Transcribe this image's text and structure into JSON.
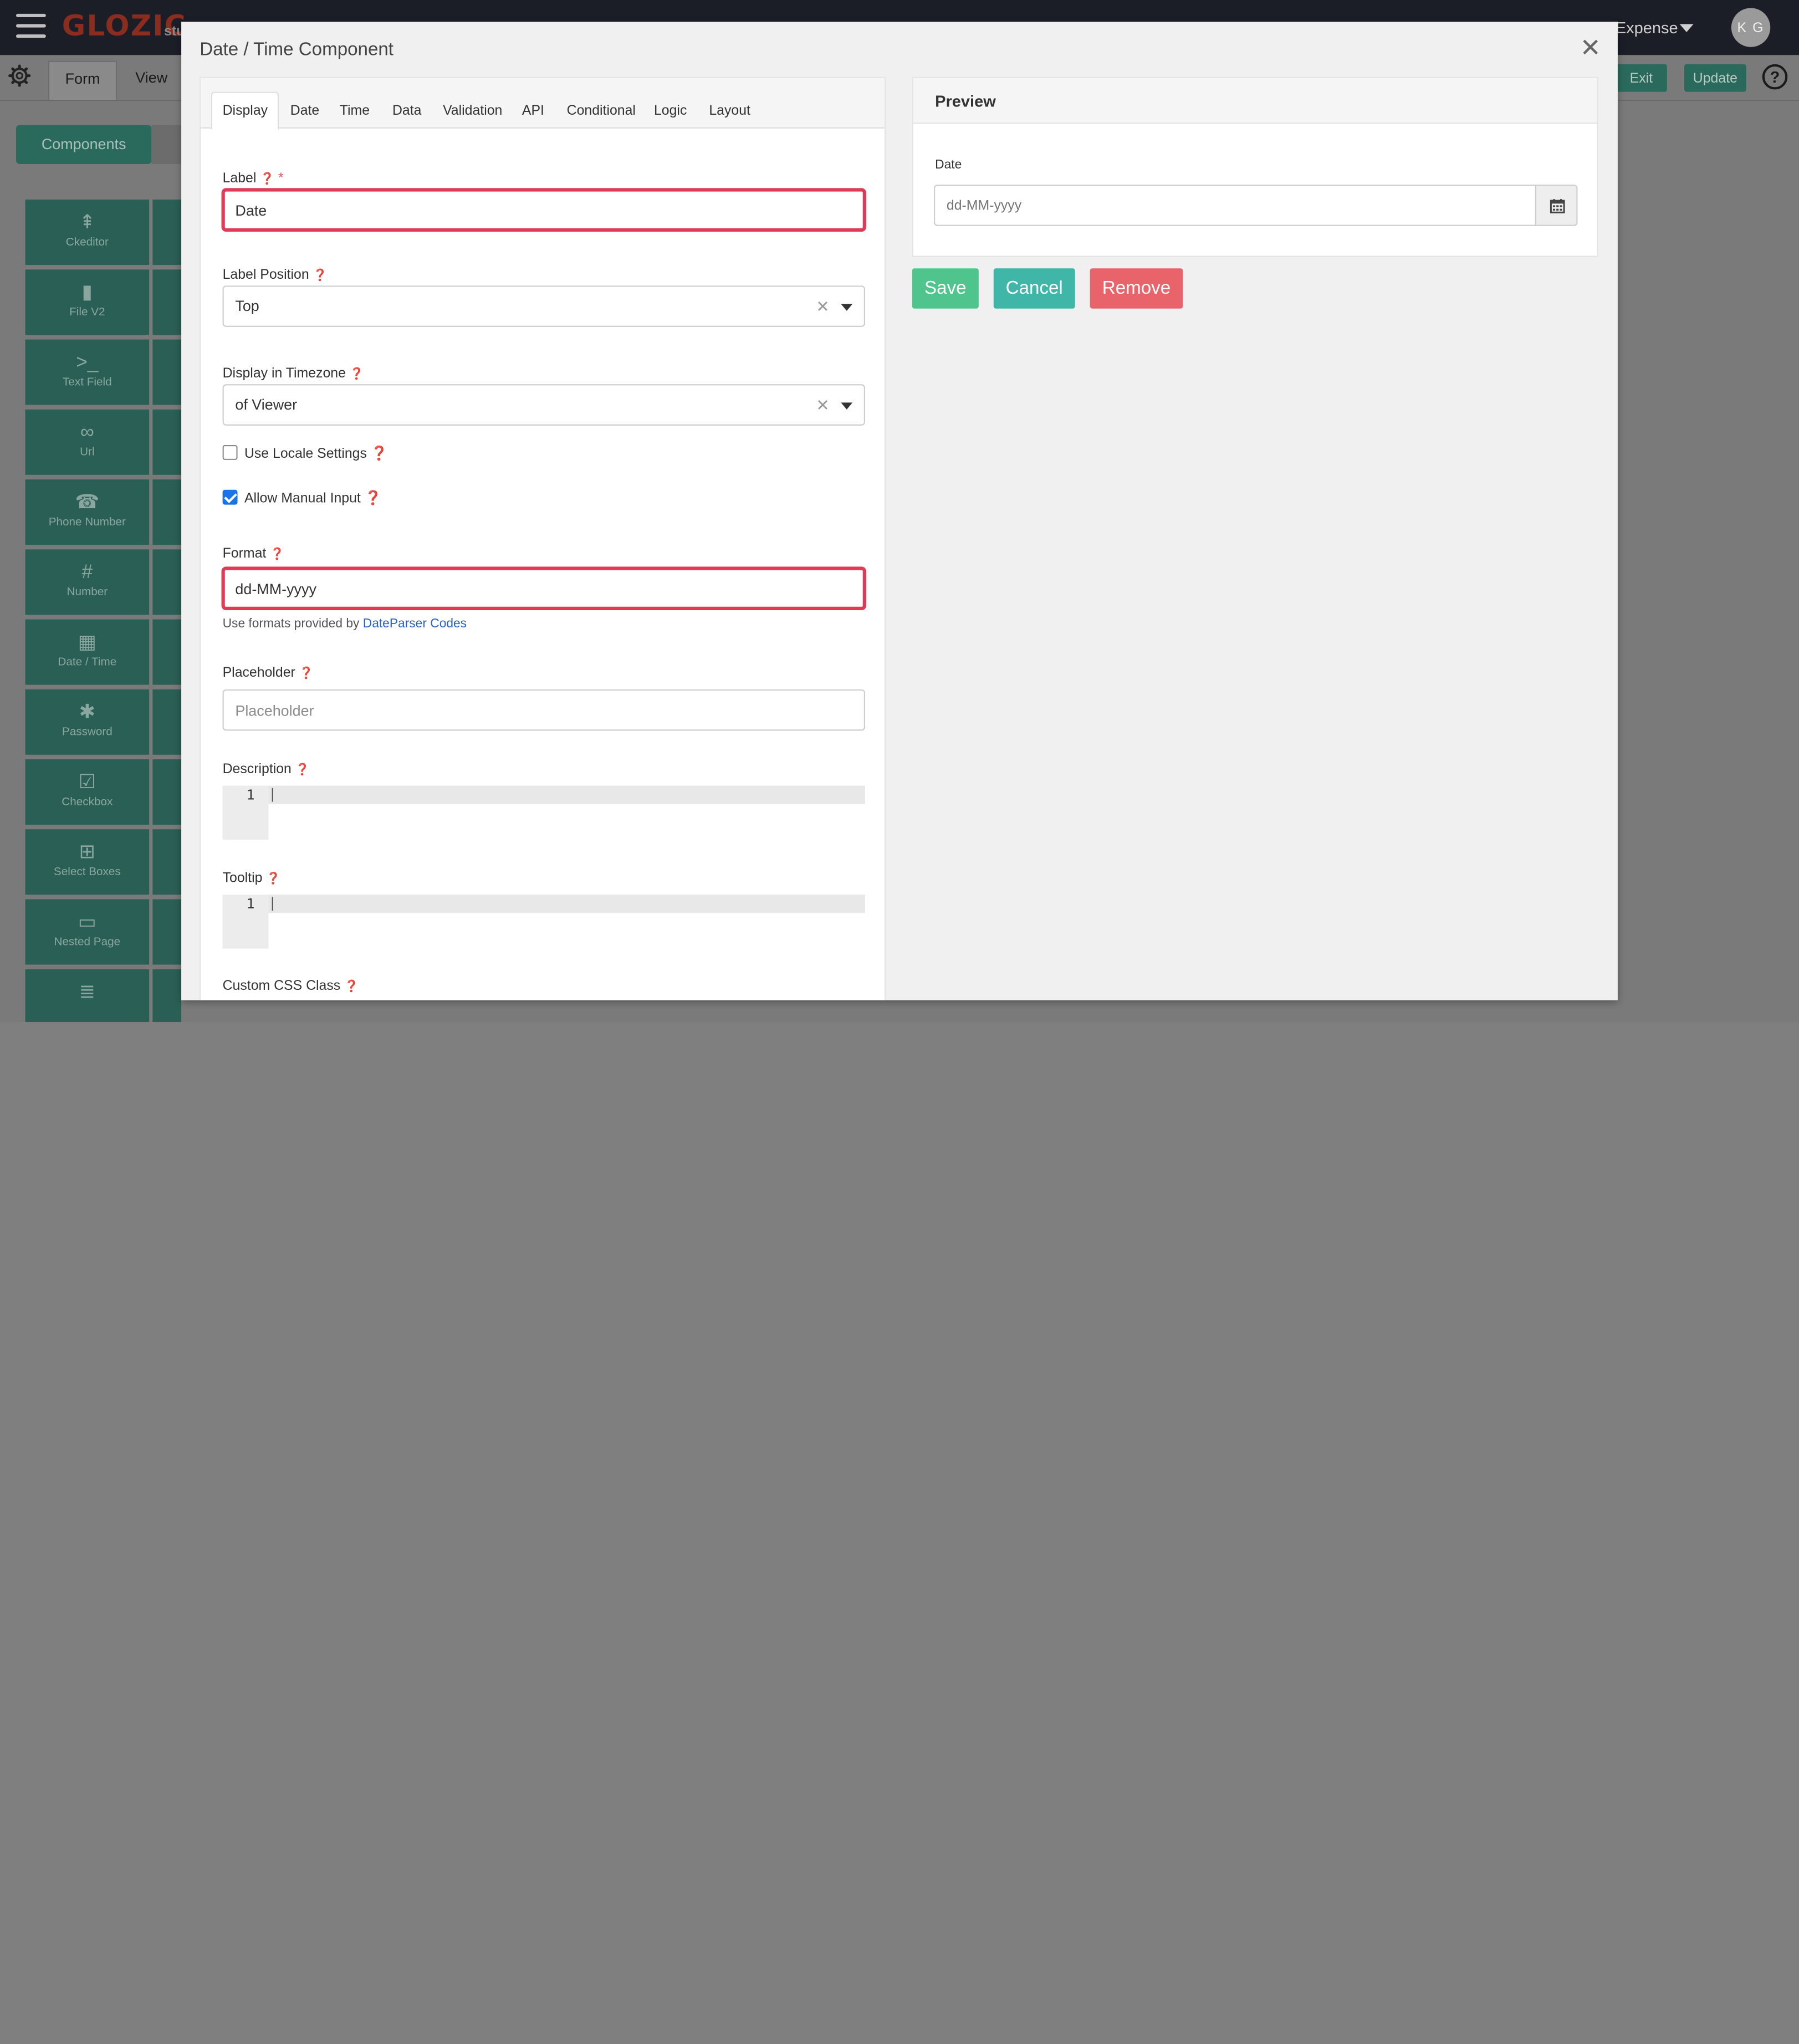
{
  "app": {
    "logo": "GLOZIC",
    "logo_sub": "stu",
    "org_name": "Expense",
    "avatar_initials": "K G",
    "tabs": {
      "form": "Form",
      "view": "View"
    },
    "exit_label": "Exit",
    "update_label": "Update",
    "components_label": "Components",
    "components": [
      {
        "label": "Ckeditor",
        "icon": "signpost-icon",
        "glyph": "⇞"
      },
      {
        "label": "File V2",
        "icon": "file-icon",
        "glyph": "▮"
      },
      {
        "label": "Text Field",
        "icon": "terminal-icon",
        "glyph": ">_"
      },
      {
        "label": "Url",
        "icon": "link-icon",
        "glyph": "∞"
      },
      {
        "label": "Phone Number",
        "icon": "phone-icon",
        "glyph": "☎"
      },
      {
        "label": "Number",
        "icon": "hash-icon",
        "glyph": "#"
      },
      {
        "label": "Date / Time",
        "icon": "calendar-icon",
        "glyph": "▦"
      },
      {
        "label": "Password",
        "icon": "asterisk-icon",
        "glyph": "✱"
      },
      {
        "label": "Checkbox",
        "icon": "checkbox-icon",
        "glyph": "☑"
      },
      {
        "label": "Select Boxes",
        "icon": "plus-square-icon",
        "glyph": "⊞"
      },
      {
        "label": "Nested Page",
        "icon": "card-icon",
        "glyph": "▭"
      },
      {
        "label": "",
        "icon": "list-icon",
        "glyph": "≣"
      }
    ]
  },
  "modal": {
    "title": "Date / Time Component",
    "tabs": [
      "Display",
      "Date",
      "Time",
      "Data",
      "Validation",
      "API",
      "Conditional",
      "Logic",
      "Layout"
    ],
    "active_tab": "Display",
    "fields": {
      "label": {
        "label": "Label",
        "value": "Date",
        "required": "*"
      },
      "label_position": {
        "label": "Label Position",
        "value": "Top"
      },
      "timezone": {
        "label": "Display in Timezone",
        "value": "of Viewer"
      },
      "use_locale": {
        "label": "Use Locale Settings",
        "checked": false
      },
      "allow_manual": {
        "label": "Allow Manual Input",
        "checked": true
      },
      "format": {
        "label": "Format",
        "value": "dd-MM-yyyy",
        "hint_prefix": "Use formats provided by ",
        "hint_link": "DateParser Codes"
      },
      "placeholder": {
        "label": "Placeholder",
        "placeholder": "Placeholder"
      },
      "description": {
        "label": "Description",
        "line_number": "1"
      },
      "tooltip": {
        "label": "Tooltip",
        "line_number": "1"
      },
      "custom_css": {
        "label": "Custom CSS Class"
      }
    },
    "preview": {
      "title": "Preview",
      "field_label": "Date",
      "field_placeholder": "dd-MM-yyyy"
    },
    "buttons": {
      "save": "Save",
      "cancel": "Cancel",
      "remove": "Remove"
    }
  },
  "colors": {
    "highlight": "#e03a57",
    "save": "#4fc58d",
    "cancel": "#3fb6a8",
    "remove": "#e8636a",
    "link": "#2962c9"
  }
}
